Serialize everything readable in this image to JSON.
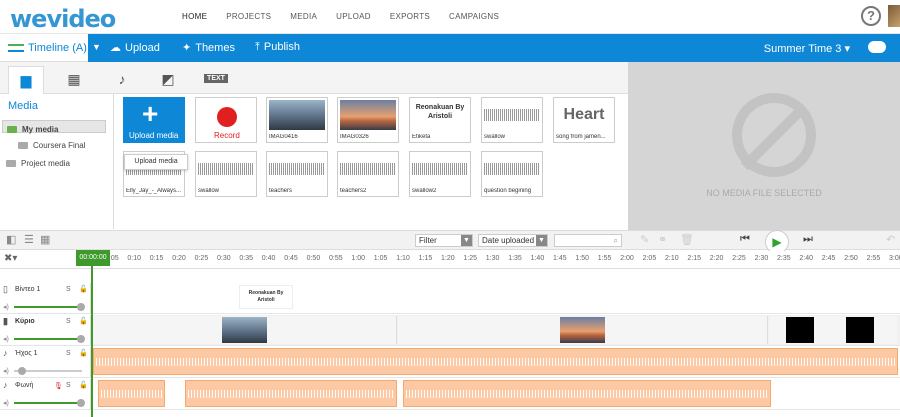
{
  "topnav": {
    "logo": "wevideo",
    "links": [
      "HOME",
      "PROJECTS",
      "MEDIA",
      "UPLOAD",
      "EXPORTS",
      "CAMPAIGNS"
    ],
    "active": "HOME",
    "help": "?"
  },
  "bluebar": {
    "timeline_label": "Timeline (A)",
    "upload": "Upload",
    "themes": "Themes",
    "publish": "Publish",
    "project": "Summer Time 3 ▾"
  },
  "media_tabs": [
    "Me",
    "film",
    "music",
    "transitions",
    "TEXT"
  ],
  "sidebar": {
    "heading": "Media",
    "folders": [
      "My media",
      "Coursera Final",
      "Project media"
    ]
  },
  "tiles": {
    "upload": "Upload media",
    "record": "Record",
    "items": [
      "IMAG0416",
      "IMAG0326",
      "Etiketa",
      "swallow",
      "song from jamen...",
      "Elly_Jay_-_Always...",
      "swallow",
      "teachers",
      "teachers2",
      "swallow2",
      "question begining"
    ],
    "etiketa_text": "Reonakuan By Aristoli",
    "heart_text": "Heart"
  },
  "tooltip": "Upload media",
  "preview": {
    "message": "NO MEDIA FILE SELECTED"
  },
  "toolbar": {
    "filter": "Filter",
    "sort": "Date uploaded",
    "search_placeholder": ""
  },
  "ruler": {
    "current": "00:00:00",
    "ticks": [
      "0:05",
      "0:10",
      "0:15",
      "0:20",
      "0:25",
      "0:30",
      "0:35",
      "0:40",
      "0:45",
      "0:50",
      "0:55",
      "1:00",
      "1:05",
      "1:10",
      "1:15",
      "1:20",
      "1:25",
      "1:30",
      "1:35",
      "1:40",
      "1:45",
      "1:50",
      "1:55",
      "2:00",
      "2:05",
      "2:10",
      "2:15",
      "2:20",
      "2:25",
      "2:30",
      "2:35",
      "2:40",
      "2:45",
      "2:50",
      "2:55",
      "3:00"
    ]
  },
  "tracks": [
    {
      "name": "Βίντεο 1",
      "s": "S"
    },
    {
      "name": "Κύριο",
      "s": "S"
    },
    {
      "name": "Ήχος 1",
      "s": "S"
    },
    {
      "name": "Φωνή",
      "s": "S"
    }
  ],
  "colors": {
    "accent": "#0d87d6",
    "green": "#3e9a2a",
    "audio": "#fcc9a4"
  }
}
